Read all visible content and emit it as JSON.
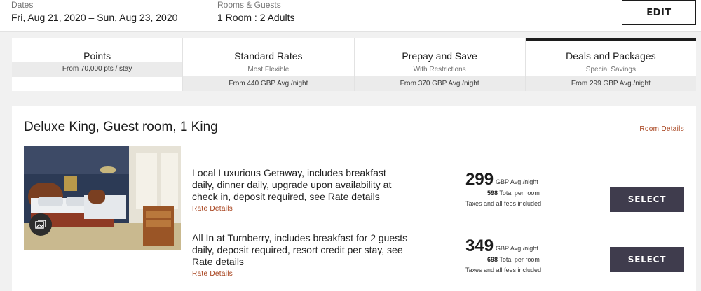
{
  "search": {
    "dates_label": "Dates",
    "dates_value": "Fri, Aug 21, 2020 – Sun, Aug 23, 2020",
    "rooms_label": "Rooms & Guests",
    "rooms_value": "1 Room : 2 Adults",
    "edit_label": "EDIT"
  },
  "tabs": [
    {
      "title": "Points",
      "subtitle": "From 70,000 pts / stay",
      "price": ""
    },
    {
      "title": "Standard Rates",
      "subtitle": "Most Flexible",
      "price": "From 440 GBP Avg./night"
    },
    {
      "title": "Prepay and Save",
      "subtitle": "With Restrictions",
      "price": "From 370 GBP Avg./night"
    },
    {
      "title": "Deals and Packages",
      "subtitle": "Special Savings",
      "price": "From 299 GBP Avg./night"
    }
  ],
  "room": {
    "title": "Deluxe King, Guest room, 1 King",
    "details_link": "Room Details",
    "rates": [
      {
        "description": "Local Luxurious Getaway, includes breakfast daily, dinner daily, upgrade upon availability at check in, deposit required, see Rate details",
        "rate_details": "Rate Details",
        "price": "299",
        "price_unit": "GBP Avg./night",
        "total_amount": "598",
        "total_label": "Total per room",
        "taxes": "Taxes and all fees included",
        "select_label": "SELECT"
      },
      {
        "description": "All In at Turnberry, includes breakfast for 2 guests daily, deposit required, resort credit per stay, see Rate details",
        "rate_details": "Rate Details",
        "price": "349",
        "price_unit": "GBP Avg./night",
        "total_amount": "698",
        "total_label": "Total per room",
        "taxes": "Taxes and all fees included",
        "select_label": "SELECT"
      }
    ]
  },
  "colors": {
    "accent_link": "#a6401a",
    "select_button": "#3f3c4d",
    "active_tab_border": "#1c1c1c"
  },
  "icons": {
    "photo_gallery": "gallery-icon"
  }
}
